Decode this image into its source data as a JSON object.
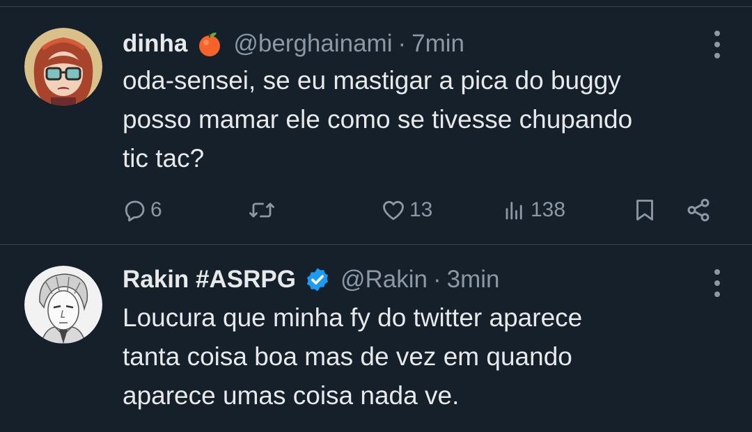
{
  "tweets": [
    {
      "name": "dinha",
      "emoji": "🍊",
      "handle": "@berghainami",
      "separator": "·",
      "time": "7min",
      "lines": [
        "oda-sensei, se eu mastigar a pica do buggy",
        "posso mamar ele como se tivesse chupando",
        "tic tac?"
      ],
      "actions": {
        "replies": "6",
        "likes": "13",
        "views": "138"
      }
    },
    {
      "name": "Rakin #ASRPG",
      "verified": true,
      "handle": "@Rakin",
      "separator": "·",
      "time": "3min",
      "lines": [
        "Loucura que minha fy do twitter aparece",
        "tanta coisa boa mas de vez em quando",
        "aparece umas coisa nada ve."
      ]
    }
  ],
  "colors": {
    "background": "#15202b",
    "text": "#e7e9ea",
    "secondary": "#8b98a5",
    "verified": "#1d9bf0",
    "divider": "#38444d"
  },
  "icons": [
    "kebab-menu-icon",
    "reply-icon",
    "retweet-icon",
    "heart-icon",
    "views-icon",
    "bookmark-icon",
    "share-icon",
    "verified-badge-icon",
    "tangerine-emoji"
  ]
}
